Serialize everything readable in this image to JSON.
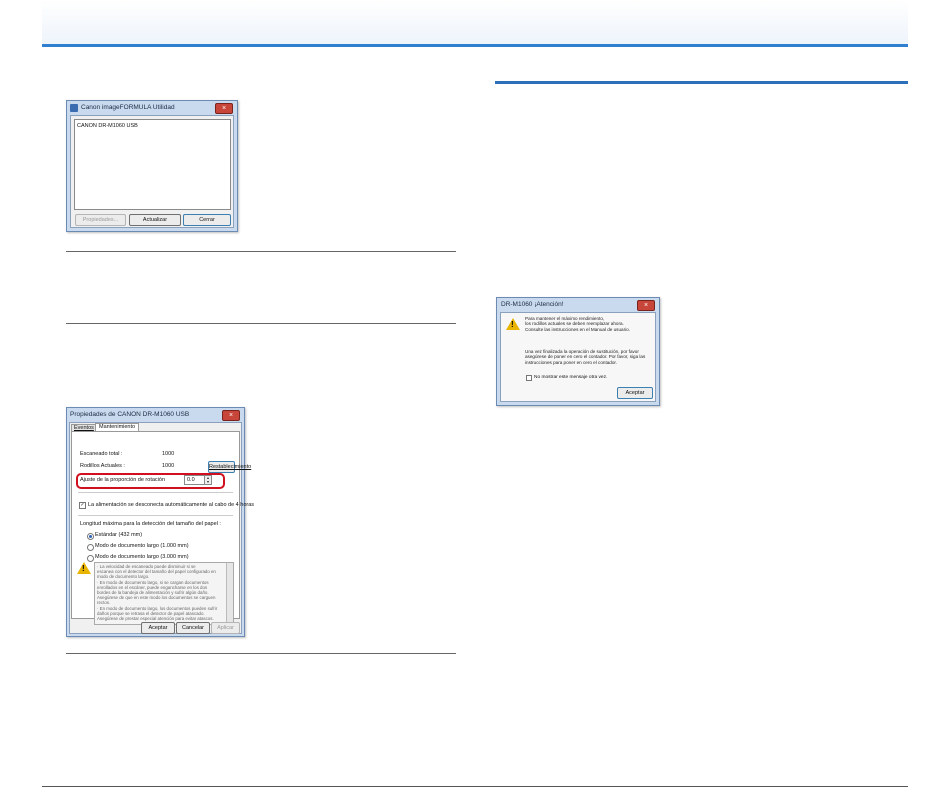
{
  "dialog_utility": {
    "title": "Canon imageFORMULA Utilidad",
    "close_label": "×",
    "device_item": "CANON DR-M1060 USB",
    "properties_button": "Propiedades...",
    "update_button": "Actualizar",
    "close_button": "Cerrar"
  },
  "dialog_properties": {
    "title": "Propiedades de CANON DR-M1060 USB",
    "close_label": "×",
    "tabs": [
      "Eventos",
      "Mantenimiento"
    ],
    "total_scans_label": "Escaneado total :",
    "total_scans_value": "1000",
    "current_rollers_label": "Rodillos Actuales :",
    "current_rollers_value": "1000",
    "reset_button": "Restablecimiento",
    "retard_label": "Ajuste de la proporción de rotación",
    "retard_value": "0.0",
    "low_power_checkbox": "La alimentación se desconecta automáticamente al cabo de 4 horas",
    "long_doc_group_label": "Longitud máxima para la detección del tamaño del papel :",
    "radio_options": [
      "Estándar (432 mm)",
      "Modo de documento largo (1.000 mm)",
      "Modo de documento largo (3.000 mm)"
    ],
    "selected_radio": 0,
    "notice_lines": [
      "· La velocidad de escaneado puede disminuir si se",
      "escanea con el detector del tamaño del papel configurado en",
      "modo de documento largo.",
      "· En modo de documento largo, si se cargan documentos",
      "enrollados en el escáner, puede engancharse en los dos",
      "bordes de la bandeja de alimentación y sufrir algún daño.",
      "Asegúrese de que en este modo los documentos se carguen",
      "rectos.",
      "· En modo de documento largo, los documentos pueden sufrir",
      "daños porque se retrasa el detector de papel atascado.",
      "Asegúrese de prestar especial atención para evitar atascos."
    ],
    "ok_button": "Aceptar",
    "cancel_button": "Cancelar",
    "apply_button": "Aplicar"
  },
  "dialog_warning": {
    "title": "DR-M1060 ¡Atención!",
    "close_label": "×",
    "message_lines": [
      "Para mantener el máximo rendimiento,",
      "los rodillos actuales se deben reemplazar ahora.",
      "Consulte las instrucciones en el Manual de usuario."
    ],
    "message2_lines": [
      "Una vez finalizada la operación de sustitución, por favor",
      "asegúrese de poner en cero el contador. Por favor, siga las",
      "instrucciones para poner en cero el contador."
    ],
    "checkbox_label": "No mostrar este mensaje otra vez.",
    "ok_button": "Aceptar"
  },
  "colors": {
    "header_blue": "#2f7fd0",
    "highlight_red": "#d0101e",
    "warning_yellow": "#e8b400"
  }
}
